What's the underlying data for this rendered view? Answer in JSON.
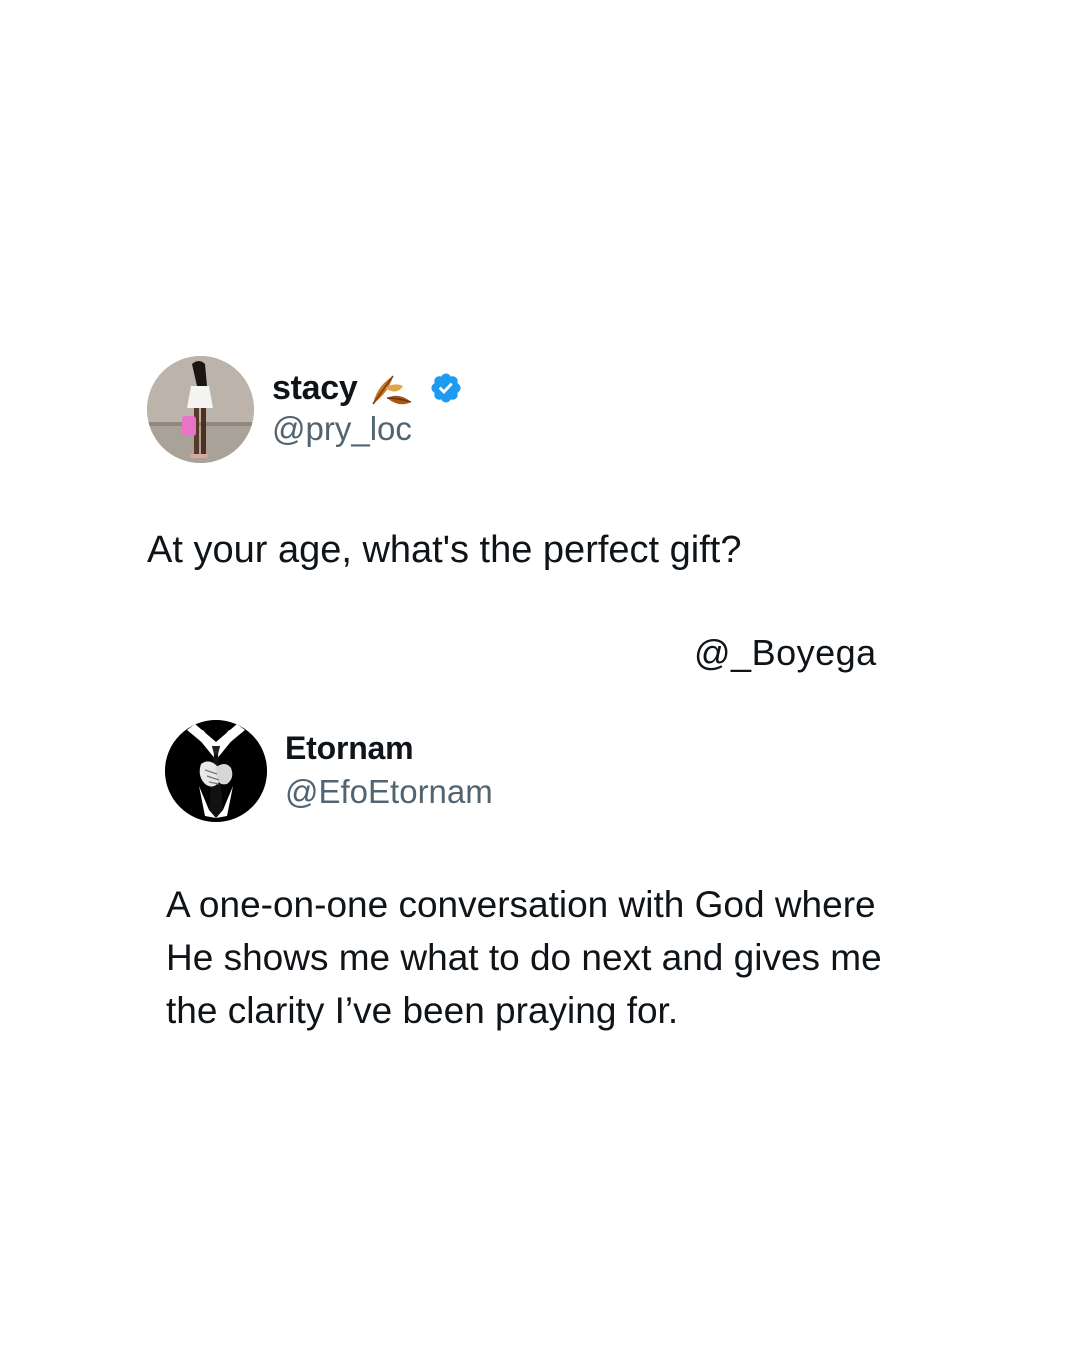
{
  "tweet_1": {
    "author_name": "stacy",
    "author_handle": "@pry_loc",
    "name_emoji_icon": "fallen-leaf-icon",
    "verified_icon": "verified-badge-icon",
    "verified_color": "#1d9bf0",
    "text": "At your age, what's the perfect gift?"
  },
  "watermark": {
    "text": "@_Boyega"
  },
  "tweet_2": {
    "author_name": "Etornam",
    "author_handle": "@EfoEtornam",
    "text_lines": [
      "A one-on-one conversation with God where",
      "He shows me what to do next and gives me",
      "the clarity I’ve been praying for."
    ]
  },
  "colors": {
    "text_primary": "#0f1419",
    "text_secondary": "#536471",
    "background": "#ffffff"
  }
}
